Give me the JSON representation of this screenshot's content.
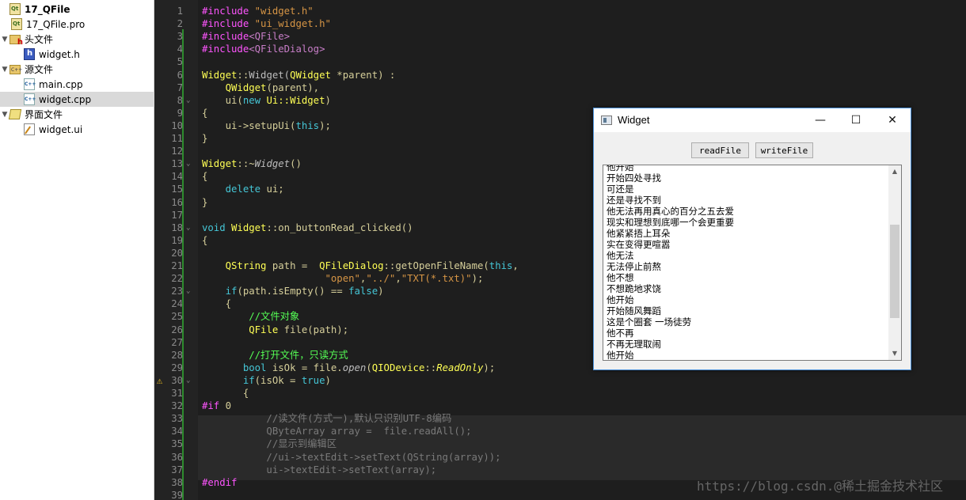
{
  "project_tree": [
    {
      "label": "17_QFile",
      "icon": "qt-project-icon",
      "bold": true,
      "indent": 0,
      "arrow": ""
    },
    {
      "label": "17_QFile.pro",
      "icon": "pro-file-icon",
      "indent": 28,
      "arrow": ""
    },
    {
      "label": "头文件",
      "icon": "header-folder-icon",
      "indent": 8,
      "arrow": "▼"
    },
    {
      "label": "widget.h",
      "icon": "header-file-icon",
      "indent": 44,
      "arrow": ""
    },
    {
      "label": "源文件",
      "icon": "source-folder-icon",
      "indent": 8,
      "arrow": "▼"
    },
    {
      "label": "main.cpp",
      "icon": "cpp-file-icon",
      "indent": 44,
      "arrow": ""
    },
    {
      "label": "widget.cpp",
      "icon": "cpp-file-icon",
      "indent": 44,
      "arrow": "",
      "selected": true
    },
    {
      "label": "界面文件",
      "icon": "forms-folder-icon",
      "indent": 8,
      "arrow": "▼"
    },
    {
      "label": "widget.ui",
      "icon": "ui-file-icon",
      "indent": 44,
      "arrow": ""
    }
  ],
  "code_lines": [
    {
      "n": "1",
      "fold": "",
      "parts": [
        [
          "pp",
          "#include "
        ],
        [
          "str",
          "\"widget.h\""
        ]
      ]
    },
    {
      "n": "2",
      "fold": "",
      "parts": [
        [
          "pp",
          "#include "
        ],
        [
          "str",
          "\"ui_widget.h\""
        ]
      ]
    },
    {
      "n": "3",
      "fold": "",
      "parts": [
        [
          "pp",
          "#include"
        ],
        [
          "pp2",
          "<QFile>"
        ]
      ]
    },
    {
      "n": "4",
      "fold": "",
      "parts": [
        [
          "pp",
          "#include"
        ],
        [
          "pp2",
          "<QFileDialog>"
        ]
      ]
    },
    {
      "n": "5",
      "fold": "",
      "parts": []
    },
    {
      "n": "6",
      "fold": "",
      "parts": [
        [
          "typ",
          "Widget"
        ],
        [
          "plain",
          "::"
        ],
        [
          "fn",
          "Widget("
        ],
        [
          "typ",
          "QWidget"
        ],
        [
          "plain",
          " *parent) :"
        ]
      ]
    },
    {
      "n": "7",
      "fold": "",
      "parts": [
        [
          "plain",
          "    "
        ],
        [
          "typ",
          "QWidget"
        ],
        [
          "plain",
          "(parent),"
        ]
      ]
    },
    {
      "n": "8",
      "fold": "⌄",
      "parts": [
        [
          "plain",
          "    ui("
        ],
        [
          "kw",
          "new "
        ],
        [
          "typ",
          "Ui::Widget"
        ],
        [
          "plain",
          ")"
        ]
      ]
    },
    {
      "n": "9",
      "fold": "",
      "parts": [
        [
          "plain",
          "{"
        ]
      ]
    },
    {
      "n": "10",
      "fold": "",
      "parts": [
        [
          "plain",
          "    ui->setupUi("
        ],
        [
          "kw",
          "this"
        ],
        [
          "plain",
          ");"
        ]
      ]
    },
    {
      "n": "11",
      "fold": "",
      "parts": [
        [
          "plain",
          "}"
        ]
      ]
    },
    {
      "n": "12",
      "fold": "",
      "parts": []
    },
    {
      "n": "13",
      "fold": "⌄",
      "parts": [
        [
          "typ",
          "Widget"
        ],
        [
          "plain",
          "::~"
        ],
        [
          "fn it",
          "Widget"
        ],
        [
          "plain",
          "()"
        ]
      ]
    },
    {
      "n": "14",
      "fold": "",
      "parts": [
        [
          "plain",
          "{"
        ]
      ]
    },
    {
      "n": "15",
      "fold": "",
      "parts": [
        [
          "plain",
          "    "
        ],
        [
          "kw",
          "delete "
        ],
        [
          "plain",
          "ui;"
        ]
      ]
    },
    {
      "n": "16",
      "fold": "",
      "parts": [
        [
          "plain",
          "}"
        ]
      ]
    },
    {
      "n": "17",
      "fold": "",
      "parts": []
    },
    {
      "n": "18",
      "fold": "⌄",
      "parts": [
        [
          "kw",
          "void "
        ],
        [
          "typ",
          "Widget"
        ],
        [
          "plain",
          "::on_buttonRead_clicked()"
        ]
      ]
    },
    {
      "n": "19",
      "fold": "",
      "parts": [
        [
          "plain",
          "{"
        ]
      ]
    },
    {
      "n": "20",
      "fold": "",
      "parts": []
    },
    {
      "n": "21",
      "fold": "",
      "parts": [
        [
          "plain",
          "    "
        ],
        [
          "typ",
          "QString"
        ],
        [
          "plain",
          " path =  "
        ],
        [
          "typ",
          "QFileDialog"
        ],
        [
          "plain",
          "::getOpenFileName("
        ],
        [
          "kw",
          "this"
        ],
        [
          "plain",
          ","
        ]
      ]
    },
    {
      "n": "22",
      "fold": "",
      "parts": [
        [
          "plain",
          "                     "
        ],
        [
          "str",
          "\"open\""
        ],
        [
          "plain",
          ","
        ],
        [
          "str",
          "\"../\""
        ],
        [
          "plain",
          ","
        ],
        [
          "str",
          "\"TXT(*.txt)\""
        ],
        [
          "plain",
          ");"
        ]
      ]
    },
    {
      "n": "23",
      "fold": "⌄",
      "parts": [
        [
          "plain",
          "    "
        ],
        [
          "kw",
          "if"
        ],
        [
          "plain",
          "(path.isEmpty() == "
        ],
        [
          "kw",
          "false"
        ],
        [
          "plain",
          ")"
        ]
      ]
    },
    {
      "n": "24",
      "fold": "",
      "parts": [
        [
          "plain",
          "    {"
        ]
      ]
    },
    {
      "n": "25",
      "fold": "",
      "parts": [
        [
          "plain",
          "        "
        ],
        [
          "cmg",
          "//文件对象"
        ]
      ]
    },
    {
      "n": "26",
      "fold": "",
      "parts": [
        [
          "plain",
          "        "
        ],
        [
          "typ",
          "QFile"
        ],
        [
          "plain",
          " file(path);"
        ]
      ]
    },
    {
      "n": "27",
      "fold": "",
      "parts": []
    },
    {
      "n": "28",
      "fold": "",
      "parts": [
        [
          "plain",
          "        "
        ],
        [
          "cmg",
          "//打开文件，只读方式"
        ]
      ]
    },
    {
      "n": "29",
      "fold": "",
      "parts": [
        [
          "plain",
          "       "
        ],
        [
          "kw",
          "bool "
        ],
        [
          "plain",
          "isOk = file."
        ],
        [
          "fn it",
          "open"
        ],
        [
          "plain",
          "("
        ],
        [
          "typ",
          "QIODevice"
        ],
        [
          "plain",
          "::"
        ],
        [
          "typ it",
          "ReadOnly"
        ],
        [
          "plain",
          ");"
        ]
      ]
    },
    {
      "n": "30",
      "fold": "⌄",
      "warn": true,
      "parts": [
        [
          "plain",
          "       "
        ],
        [
          "kw",
          "if"
        ],
        [
          "plain",
          "(isOk = "
        ],
        [
          "kw",
          "true"
        ],
        [
          "plain",
          ")"
        ]
      ]
    },
    {
      "n": "31",
      "fold": "",
      "parts": [
        [
          "plain",
          "       {"
        ]
      ]
    },
    {
      "n": "32",
      "fold": "",
      "parts": [
        [
          "pp",
          "#if "
        ],
        [
          "plain",
          "0"
        ]
      ]
    },
    {
      "n": "33",
      "fold": "",
      "parts": [
        [
          "dim",
          "           //读文件(方式一),默认只识别UTF-8编码"
        ]
      ]
    },
    {
      "n": "34",
      "fold": "",
      "parts": [
        [
          "dim",
          "           QByteArray array =  file.readAll();"
        ]
      ]
    },
    {
      "n": "35",
      "fold": "",
      "parts": [
        [
          "dim",
          "           //显示到编辑区"
        ]
      ]
    },
    {
      "n": "36",
      "fold": "",
      "parts": [
        [
          "dim",
          "           //ui->textEdit->setText(QString(array));"
        ]
      ]
    },
    {
      "n": "37",
      "fold": "",
      "parts": [
        [
          "dim",
          "           ui->textEdit->setText(array);"
        ]
      ]
    },
    {
      "n": "38",
      "fold": "",
      "parts": [
        [
          "pp",
          "#endif"
        ]
      ]
    },
    {
      "n": "39",
      "fold": "",
      "parts": []
    }
  ],
  "widget_window": {
    "title": "Widget",
    "minimize": "—",
    "maximize": "☐",
    "close": "✕",
    "read_button": "readFile",
    "write_button": "writeFile",
    "text_lines": [
      "他开始",
      "开始四处寻找",
      "可还是",
      "还是寻找不到",
      "他无法再用真心的百分之五去爱",
      "现实和理想到底哪一个会更重要",
      "他紧紧捂上耳朵",
      "实在变得更喧嚣",
      "他无法",
      "无法停止前熬",
      "他不想",
      "不想跪地求饶",
      "他开始",
      "开始随风舞蹈",
      "这是个圈套 一场徒劳",
      "他不再",
      "不再无理取闹",
      "他开始"
    ]
  },
  "watermark": "https://blog.csdn.@稀土掘金技术社区"
}
